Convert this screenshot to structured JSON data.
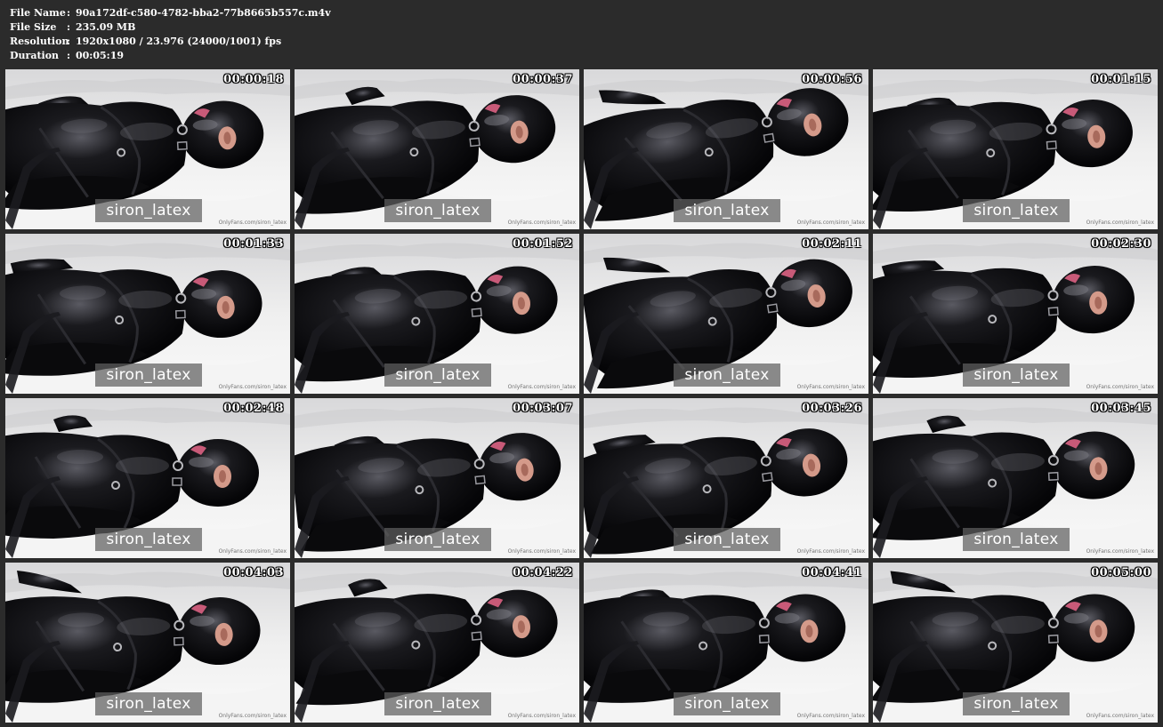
{
  "file_info": [
    {
      "label": "File Name",
      "value": "90a172df-c580-4782-bba2-77b8665b557c.m4v"
    },
    {
      "label": "File Size",
      "value": "235.09 MB"
    },
    {
      "label": "Resolution",
      "value": "1920x1080 / 23.976 (24000/1001) fps"
    },
    {
      "label": "Duration",
      "value": "00:05:19"
    }
  ],
  "separator": ":",
  "watermark": "siron_latex",
  "corner_credit": "OnlyFans.com/siron_latex",
  "colors": {
    "background": "#2b2b2b",
    "sheet": "#e9e9e9",
    "latex": "#0d0d10",
    "watermark_bg": "#5f5f5f"
  },
  "thumbnails": [
    {
      "timestamp": "00:00:18"
    },
    {
      "timestamp": "00:00:37"
    },
    {
      "timestamp": "00:00:56"
    },
    {
      "timestamp": "00:01:15"
    },
    {
      "timestamp": "00:01:33"
    },
    {
      "timestamp": "00:01:52"
    },
    {
      "timestamp": "00:02:11"
    },
    {
      "timestamp": "00:02:30"
    },
    {
      "timestamp": "00:02:48"
    },
    {
      "timestamp": "00:03:07"
    },
    {
      "timestamp": "00:03:26"
    },
    {
      "timestamp": "00:03:45"
    },
    {
      "timestamp": "00:04:03"
    },
    {
      "timestamp": "00:04:22"
    },
    {
      "timestamp": "00:04:41"
    },
    {
      "timestamp": "00:05:00"
    }
  ]
}
